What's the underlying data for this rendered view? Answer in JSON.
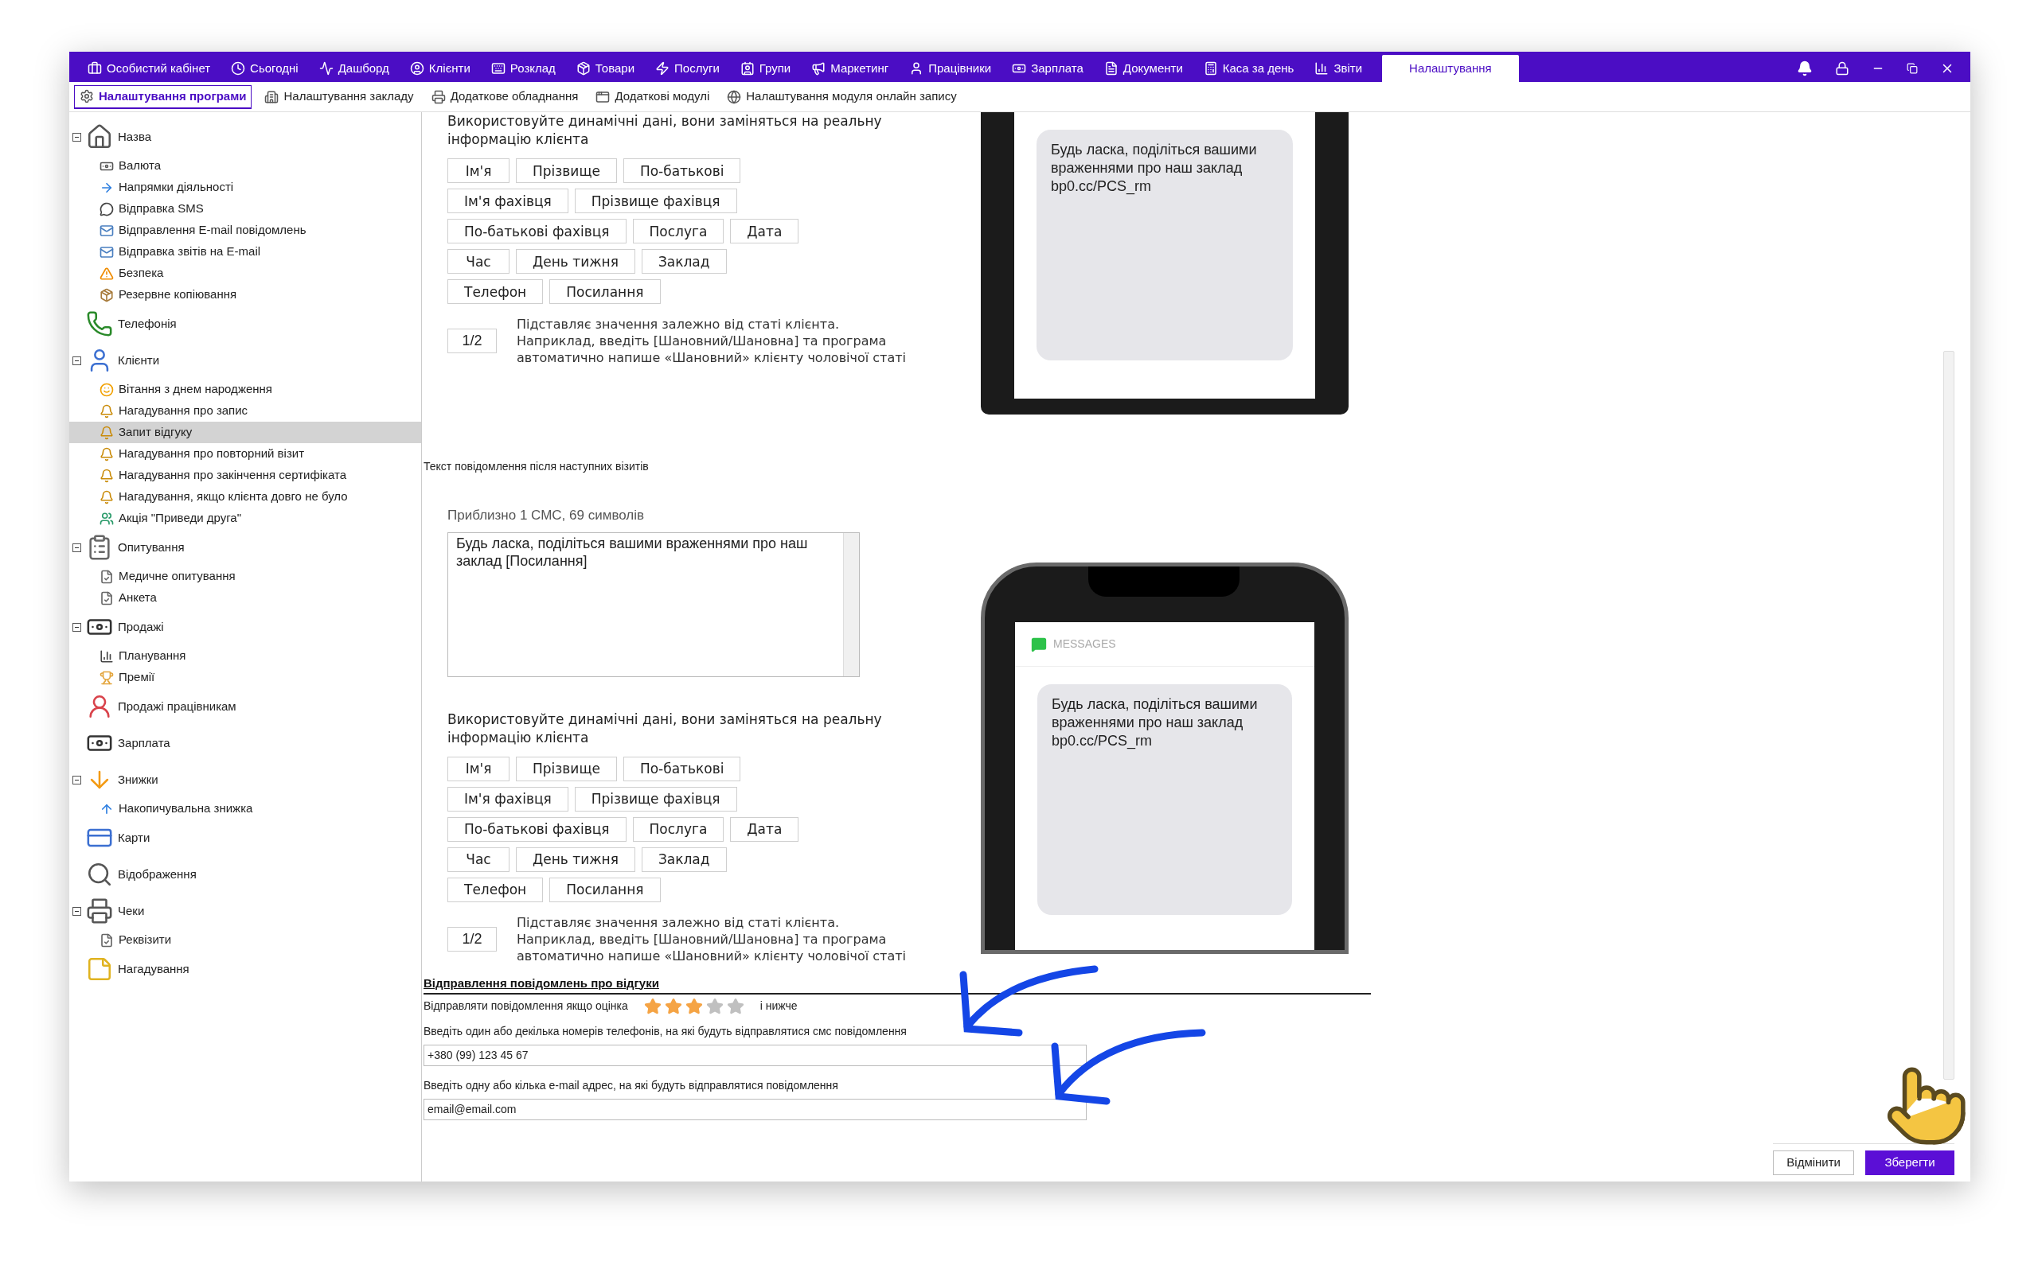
{
  "top_nav": [
    {
      "label": "Особистий кабінет",
      "selected": false
    },
    {
      "label": "Сьогодні",
      "selected": false
    },
    {
      "label": "Дашборд",
      "selected": false
    },
    {
      "label": "Клієнти",
      "selected": false
    },
    {
      "label": "Розклад",
      "selected": false
    },
    {
      "label": "Товари",
      "selected": false
    },
    {
      "label": "Послуги",
      "selected": false
    },
    {
      "label": "Групи",
      "selected": false
    },
    {
      "label": "Маркетинг",
      "selected": false
    },
    {
      "label": "Працівники",
      "selected": false
    },
    {
      "label": "Зарплата",
      "selected": false
    },
    {
      "label": "Документи",
      "selected": false
    },
    {
      "label": "Каса за день",
      "selected": false
    },
    {
      "label": "Звіти",
      "selected": false
    },
    {
      "label": "Налаштування",
      "selected": true
    }
  ],
  "sub_tabs": [
    {
      "label": "Налаштування програми",
      "selected": true
    },
    {
      "label": "Налаштування закладу",
      "selected": false
    },
    {
      "label": "Додаткове обладнання",
      "selected": false
    },
    {
      "label": "Додаткові модулі",
      "selected": false
    },
    {
      "label": "Налаштування модуля онлайн запису",
      "selected": false
    }
  ],
  "sidebar": {
    "items": [
      {
        "label": "Назва",
        "selected": false,
        "expanded": true,
        "children": [
          {
            "label": "Валюта",
            "selected": false
          },
          {
            "label": "Напрямки діяльності",
            "selected": false
          },
          {
            "label": "Відправка SMS",
            "selected": false
          },
          {
            "label": "Відправлення E-mail повідомлень",
            "selected": false
          },
          {
            "label": "Відправка звітів на E-mail",
            "selected": false
          },
          {
            "label": "Безпека",
            "selected": false
          },
          {
            "label": "Резервне копіювання",
            "selected": false
          }
        ]
      },
      {
        "label": "Телефонія",
        "selected": false
      },
      {
        "label": "Клієнти",
        "selected": false,
        "expanded": true,
        "children": [
          {
            "label": "Вітання з днем народження",
            "selected": false
          },
          {
            "label": "Нагадування про запис",
            "selected": false
          },
          {
            "label": "Запит відгуку",
            "selected": true
          },
          {
            "label": "Нагадування про повторний візит",
            "selected": false
          },
          {
            "label": "Нагадування про закінчення сертифіката",
            "selected": false
          },
          {
            "label": "Нагадування, якщо клієнта довго не було",
            "selected": false
          },
          {
            "label": "Акція \"Приведи друга\"",
            "selected": false
          }
        ]
      },
      {
        "label": "Опитування",
        "selected": false,
        "expanded": true,
        "children": [
          {
            "label": "Медичне опитування",
            "selected": false
          },
          {
            "label": "Анкета",
            "selected": false
          }
        ]
      },
      {
        "label": "Продажі",
        "selected": false,
        "expanded": true,
        "children": [
          {
            "label": "Планування",
            "selected": false
          },
          {
            "label": "Премії",
            "selected": false
          }
        ]
      },
      {
        "label": "Продажі працівникам",
        "selected": false
      },
      {
        "label": "Зарплата",
        "selected": false
      },
      {
        "label": "Знижки",
        "selected": false,
        "expanded": true,
        "children": [
          {
            "label": "Накопичувальна знижка",
            "selected": false
          }
        ]
      },
      {
        "label": "Карти",
        "selected": false
      },
      {
        "label": "Відображення",
        "selected": false
      },
      {
        "label": "Чеки",
        "selected": false,
        "expanded": true,
        "children": [
          {
            "label": "Реквізити",
            "selected": false
          }
        ]
      },
      {
        "label": "Нагадування",
        "selected": false
      }
    ]
  },
  "first_visit": {
    "dynamic_hint": "Використовуйте динамічні дані, вони заміняться на реальну інформацію клієнта",
    "variable_rows": [
      [
        "Ім'я",
        "Прізвище",
        "По-батькові"
      ],
      [
        "Ім'я фахівця",
        "Прізвище фахівця"
      ],
      [
        "По-батькові фахівця",
        "Послуга",
        "Дата"
      ],
      [
        "Час",
        "День тижня",
        "Заклад"
      ],
      [
        "Телефон",
        "Посилання"
      ]
    ],
    "gender_button": "1/2",
    "gender_hint": "Підставляє значення залежно від статі клієнта. Наприклад, введіть [Шановний/Шановна] та програма автоматично напише «Шановний» клієнту чоловічої статі",
    "preview": {
      "message": "Будь ласка, поділіться вашими враженнями про наш заклад bp0.cc/PCS_rm"
    }
  },
  "next_visits": {
    "section_label": "Текст повідомлення після наступних візитів",
    "counter": "Приблизно 1 СМС, 69 символів",
    "message": "Будь ласка, поділіться вашими враженнями про наш заклад [Посилання]",
    "dynamic_hint": "Використовуйте динамічні дані, вони заміняться на реальну інформацію клієнта",
    "variable_rows": [
      [
        "Ім'я",
        "Прізвище",
        "По-батькові"
      ],
      [
        "Ім'я фахівця",
        "Прізвище фахівця"
      ],
      [
        "По-батькові фахівця",
        "Послуга",
        "Дата"
      ],
      [
        "Час",
        "День тижня",
        "Заклад"
      ],
      [
        "Телефон",
        "Посилання"
      ]
    ],
    "gender_button": "1/2",
    "gender_hint": "Підставляє значення залежно від статі клієнта. Наприклад, введіть [Шановний/Шановна] та програма автоматично напише «Шановний» клієнту чоловічої статі",
    "preview": {
      "app_label": "MESSAGES",
      "message": "Будь ласка, поділіться вашими враженнями про наш заклад bp0.cc/PCS_rm"
    }
  },
  "feedback": {
    "title": "Відправлення повідомлень про відгуки",
    "rating_label": "Відправляти повідомлення якщо оцінка",
    "stars": 3,
    "rating_suffix": "і нижче",
    "phone_label": "Введіть один або декілька номерів телефонів, на які будуть відправлятися смс повідомлення",
    "phone_value": "+380 (99) 123 45 67",
    "email_label": "Введіть одну або кілька e-mail адрес, на які будуть відправлятися повідомлення",
    "email_value": "email@email.com"
  },
  "footer_buttons": [
    {
      "label": "Відмінити",
      "kind": "secondary"
    },
    {
      "label": "Зберегти",
      "kind": "primary"
    }
  ]
}
